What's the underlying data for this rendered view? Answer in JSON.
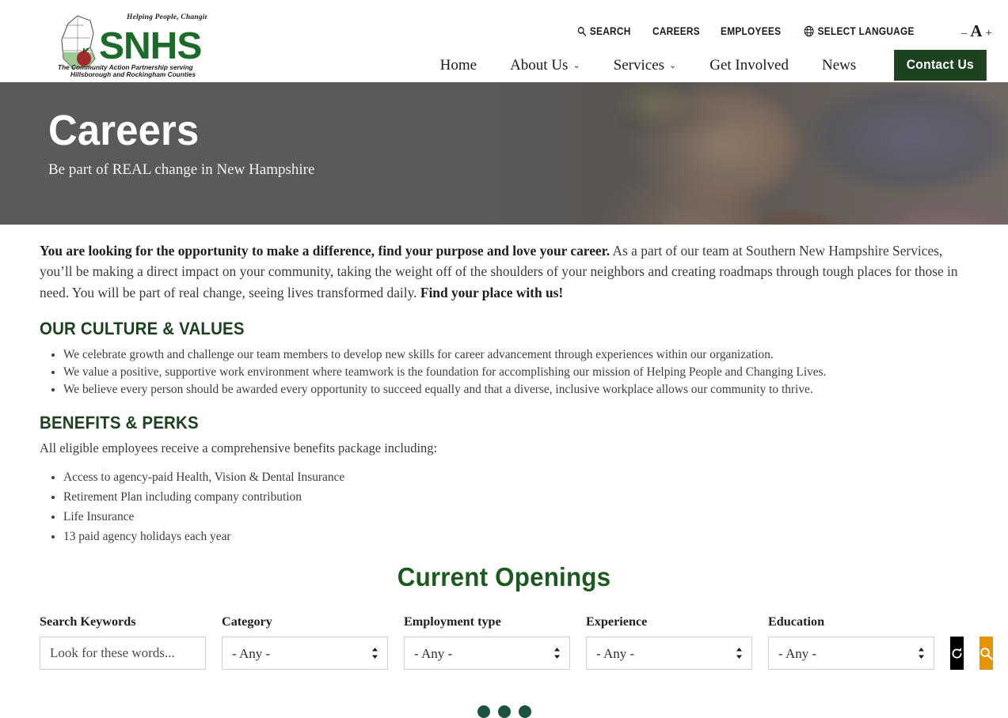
{
  "header": {
    "logo": {
      "tagline_top": "Helping People, Changing Lives.",
      "wordmark": "SNHS",
      "tagline_bottom_1": "The Community Action Partnership serving",
      "tagline_bottom_2": "Hillsborough and Rockingham Counties"
    },
    "utility_nav": [
      {
        "label": "SEARCH",
        "icon": "search-icon"
      },
      {
        "label": "CAREERS",
        "icon": ""
      },
      {
        "label": "EMPLOYEES",
        "icon": ""
      },
      {
        "label": "SELECT LANGUAGE",
        "icon": "globe-icon"
      }
    ],
    "font_size_control": {
      "decrease": "–",
      "letter": "A",
      "increase": "+"
    },
    "main_nav": [
      {
        "label": "Home",
        "has_dropdown": false
      },
      {
        "label": "About Us",
        "has_dropdown": true
      },
      {
        "label": "Services",
        "has_dropdown": true
      },
      {
        "label": "Get Involved",
        "has_dropdown": false
      },
      {
        "label": "News",
        "has_dropdown": false
      }
    ],
    "cta": "Contact Us"
  },
  "hero": {
    "title": "Careers",
    "subtitle": "Be part of REAL change in New Hampshire"
  },
  "intro": {
    "bold_lead": "You are looking for the opportunity to make a difference, find your purpose and love your career.",
    "body": " As a part of our team at Southern New Hampshire Services, you’ll be making a direct impact on your community, taking the weight off of the shoulders of your neighbors and creating roadmaps through tough places for those in need. You will be part of real change, seeing lives transformed daily. ",
    "bold_tail": "Find your place with us!"
  },
  "culture": {
    "heading": "OUR CULTURE & VALUES",
    "items": [
      "We celebrate growth and challenge our team members to develop new skills for career advancement through experiences within our organization.",
      "We value a positive, supportive work environment where teamwork is the foundation for accomplishing our mission of Helping People and Changing Lives.",
      "We believe every person should be awarded every opportunity to succeed equally and that a diverse, inclusive workplace allows our community to thrive."
    ]
  },
  "benefits": {
    "heading": "BENEFITS & PERKS",
    "lead": "All eligible employees receive a comprehensive benefits package including:",
    "items": [
      "Access to agency-paid Health, Vision & Dental Insurance",
      "Retirement Plan including company contribution",
      "Life Insurance",
      "13 paid agency holidays each year"
    ]
  },
  "openings": {
    "title": "Current Openings",
    "filters": [
      {
        "label": "Search Keywords",
        "type": "text",
        "placeholder": "Look for these words...",
        "value": ""
      },
      {
        "label": "Category",
        "type": "select",
        "value": "- Any -"
      },
      {
        "label": "Employment type",
        "type": "select",
        "value": "- Any -"
      },
      {
        "label": "Experience",
        "type": "select",
        "value": "- Any -"
      },
      {
        "label": "Education",
        "type": "select",
        "value": "- Any -"
      }
    ],
    "reset_button_icon": "refresh-icon",
    "search_button_icon": "search-icon",
    "loading_dots": 3
  },
  "colors": {
    "brand_green": "#1d4220",
    "heading_green": "#1d5a1f",
    "accent_orange": "#e59400",
    "reset_black": "#000000",
    "dot_green": "#1d5240",
    "hero_overlay_gray": "#5a5a5a"
  }
}
